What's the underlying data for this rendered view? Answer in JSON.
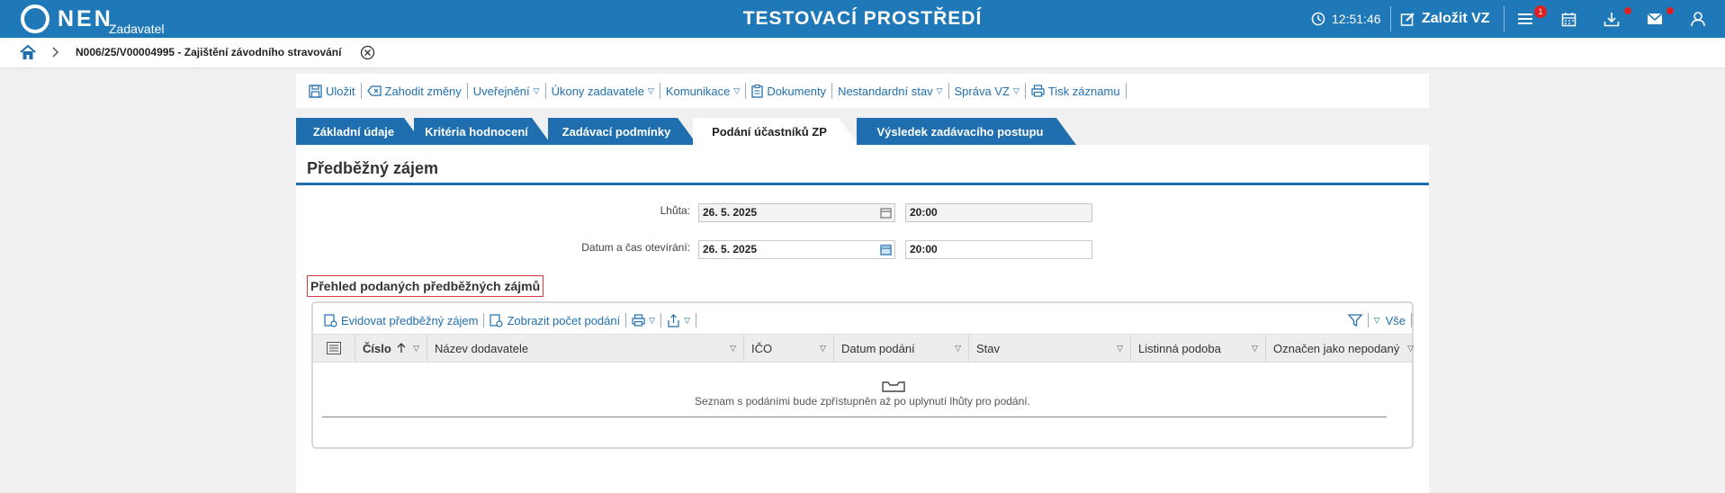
{
  "header": {
    "logo_text": "NEN",
    "logo_sub": "Zadavatel",
    "environment_title": "TESTOVACÍ PROSTŘEDÍ",
    "clock": "12:51:46",
    "create_button": "Založit VZ",
    "menu_badge": "1"
  },
  "breadcrumb": {
    "title": "N006/25/V00004995 - Zajištění závodního stravování"
  },
  "toolbar": {
    "save": "Uložit",
    "discard": "Zahodit změny",
    "publish": "Uveřejnění",
    "actions": "Úkony zadavatele",
    "communication": "Komunikace",
    "documents": "Dokumenty",
    "nonstandard": "Nestandardní stav",
    "admin": "Správa VZ",
    "print": "Tisk záznamu"
  },
  "tabs": [
    {
      "label": "Základní údaje"
    },
    {
      "label": "Kritéria hodnocení"
    },
    {
      "label": "Zadávací podmínky"
    },
    {
      "label": "Podání účastníků ZP"
    },
    {
      "label": "Výsledek zadávacího postupu"
    }
  ],
  "active_tab": "Podání účastníků ZP",
  "section": {
    "title": "Předběžný zájem"
  },
  "form": {
    "deadline_label": "Lhůta:",
    "deadline_date": "26. 5. 2025",
    "deadline_time": "20:00",
    "opening_label": "Datum a čas otevírání:",
    "opening_date": "26. 5. 2025",
    "opening_time": "20:00"
  },
  "overview": {
    "title": "Přehled podaných předběžných zájmů",
    "tool_register": "Evidovat předběžný zájem",
    "tool_count": "Zobrazit počet podání",
    "filter_all": "Vše",
    "columns": [
      "Číslo",
      "Název dodavatele",
      "IČO",
      "Datum podání",
      "Stav",
      "Listinná podoba",
      "Označen jako nepodaný"
    ],
    "empty_message": "Seznam s podáními bude zpřístupněn až po uplynutí lhůty pro podání."
  },
  "colors": {
    "primary": "#1f78b8",
    "accent": "#1f6fb0",
    "highlight_border": "#d9363e"
  }
}
